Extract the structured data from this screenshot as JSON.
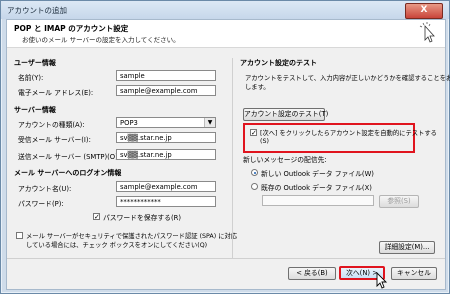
{
  "window": {
    "title": "アカウントの追加",
    "close_label": "X"
  },
  "header": {
    "title": "POP と IMAP のアカウント設定",
    "subtitle": "お使いのメール サーバーの設定を入力してください。"
  },
  "user_info": {
    "heading": "ユーザー情報",
    "name_label": "名前(Y):",
    "name_value": "sample",
    "email_label": "電子メール アドレス(E):",
    "email_value": "sample@example.com"
  },
  "server_info": {
    "heading": "サーバー情報",
    "account_type_label": "アカウントの種類(A):",
    "account_type_value": "POP3",
    "incoming_label": "受信メール サーバー(I):",
    "incoming_value": "sv▒▒.star.ne.jp",
    "outgoing_label": "送信メール サーバー (SMTP)(O):",
    "outgoing_value": "sv▒▒.star.ne.jp"
  },
  "login_info": {
    "heading": "メール サーバーへのログオン情報",
    "account_label": "アカウント名(U):",
    "account_value": "sample@example.com",
    "password_label": "パスワード(P):",
    "password_value": "************",
    "save_password_label": "パスワードを保存する(R)",
    "spa_label_line1": "メール サーバーがセキュリティで保護されたパスワード認証 (SPA) に対応",
    "spa_label_line2": "している場合には、チェック ボックスをオンにしてください(Q)"
  },
  "test": {
    "heading": "アカウント設定のテスト",
    "desc_line1": "アカウントをテストして、入力内容が正しいかどうかを確認することをお勧め",
    "desc_line2": "します。",
    "test_button": "アカウント設定のテスト(T)",
    "auto_test_line1": "[次へ] をクリックしたらアカウント設定を自動的にテストする",
    "auto_test_line2": "(S)",
    "delivery_heading": "新しいメッセージの配信先:",
    "new_file_label": "新しい Outlook データ ファイル(W)",
    "existing_file_label": "既存の Outlook データ ファイル(X)",
    "browse_button": "参照(S)",
    "more_settings_button": "詳細設定(M)..."
  },
  "footer": {
    "back_button": "< 戻る(B)",
    "next_button": "次へ(N) >",
    "cancel_button": "キャンセル"
  }
}
